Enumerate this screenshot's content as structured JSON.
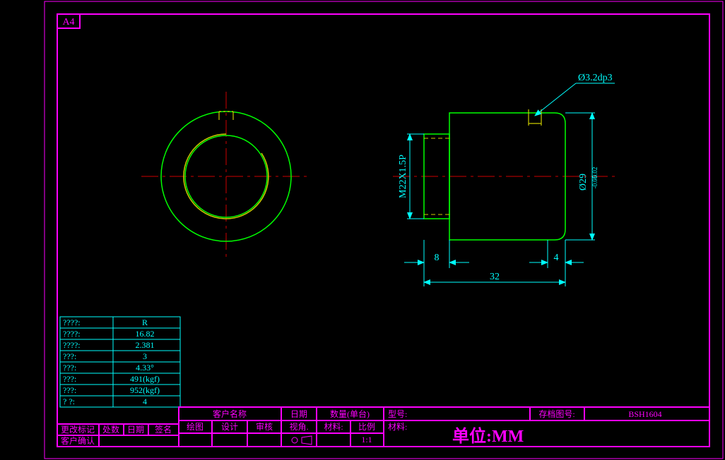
{
  "sheet": {
    "format": "A4"
  },
  "colors": {
    "frame": "#ff00ff",
    "dim": "#00ffff",
    "part": "#00ff00",
    "center": "#cc0000",
    "gold": "#cccc00"
  },
  "callout": {
    "text": "Ø3.2dp3"
  },
  "dims": {
    "thread": "M22X1.5P",
    "diameter": "Ø29",
    "tol_upper": "-0.02",
    "tol_lower": "-0.05",
    "len8": "8",
    "len4": "4",
    "len32": "32"
  },
  "spec_table": {
    "label_col": [
      "????:",
      "????:",
      "????:",
      "???:",
      "???:",
      "???:",
      "???:",
      "?  ?:"
    ],
    "value_col": [
      "R",
      "16.82",
      "2.381",
      "3",
      "4.33°",
      "491(kgf)",
      "952(kgf)",
      "4"
    ]
  },
  "change_block": {
    "row1": [
      "更改标记",
      "处数",
      "日期",
      "签名"
    ],
    "row2_label": "客户确认"
  },
  "titleblock": {
    "labels": {
      "customer": "客户名称",
      "date": "日期",
      "qty": "数量(单台)",
      "model": "型号:",
      "archive": "存档图号:",
      "material": "材料:"
    },
    "row2_labels": {
      "drawn": "绘图",
      "design": "设计",
      "check": "审核",
      "view": "视角.",
      "scale": "比例"
    },
    "values": {
      "archive_no": "BSH1604",
      "scale": "1:1"
    },
    "unit_label": "单位:MM"
  }
}
